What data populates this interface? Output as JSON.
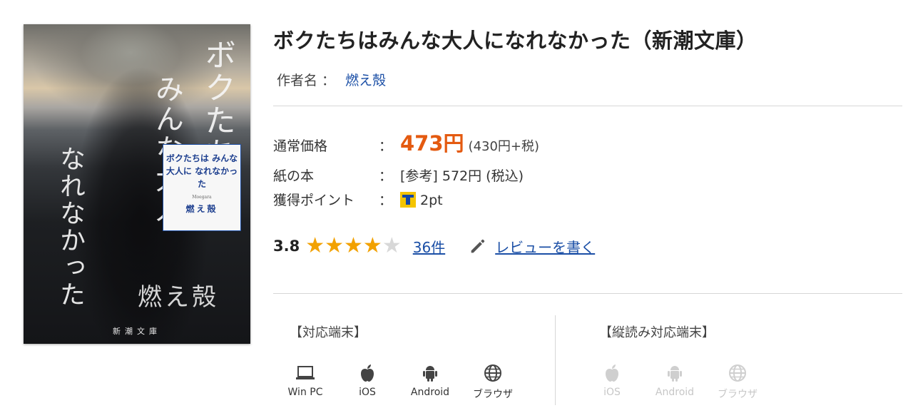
{
  "cover": {
    "label_title": "ボクたちは みんな大人に なれなかった",
    "label_sub": "Moegara",
    "label_author": "燃え殻",
    "publisher": "新潮文庫",
    "scribble_1": "ボクたち",
    "scribble_2": "みんな大人",
    "scribble_3": "なれなかった",
    "author_hand": "燃え殻"
  },
  "book": {
    "title": "ボクたちはみんな大人になれなかった（新潮文庫）",
    "author_label": "作者名 ：",
    "author_name": "燃え殻"
  },
  "price": {
    "regular_label": "通常価格",
    "colon": "：",
    "regular_value": "473円",
    "regular_breakdown": "(430円+税)",
    "paper_label": "紙の本",
    "paper_value": "[参考] 572円 (税込)",
    "points_label": "獲得ポイント",
    "points_value": "2pt"
  },
  "rating": {
    "score": "3.8",
    "stars_filled": 4,
    "stars_total": 5,
    "review_count": "36件",
    "write_review": "レビューを書く"
  },
  "devices": {
    "supported_title": "【対応端末】",
    "vertical_title": "【縦読み対応端末】",
    "supported": [
      {
        "label": "Win PC",
        "icon": "laptop-icon"
      },
      {
        "label": "iOS",
        "icon": "apple-icon"
      },
      {
        "label": "Android",
        "icon": "android-icon"
      },
      {
        "label": "ブラウザ",
        "icon": "globe-icon"
      }
    ],
    "vertical": [
      {
        "label": "iOS",
        "icon": "apple-icon"
      },
      {
        "label": "Android",
        "icon": "android-icon"
      },
      {
        "label": "ブラウザ",
        "icon": "globe-icon"
      }
    ]
  },
  "colors": {
    "link": "#1b4fa6",
    "price": "#e45a10",
    "star": "#f2a100",
    "disabled": "#c7c7c7"
  }
}
